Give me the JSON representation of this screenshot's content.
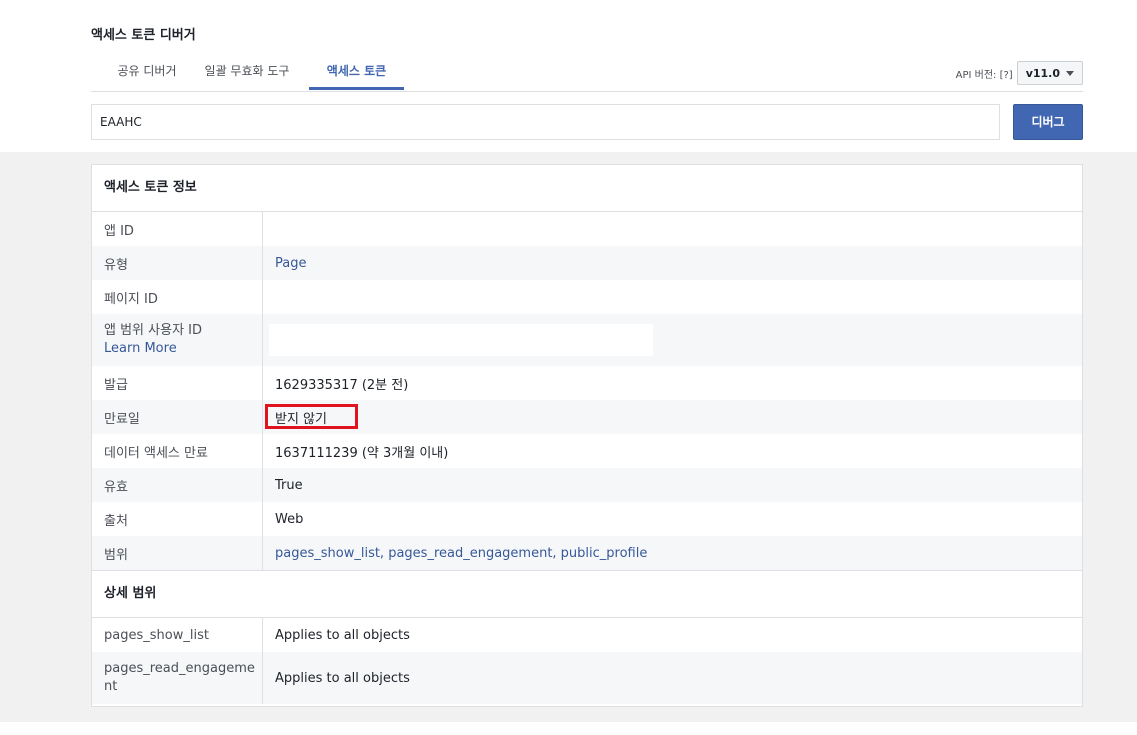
{
  "header": {
    "title": "액세스 토큰 디버거",
    "tabs": [
      {
        "label": "공유 디버거"
      },
      {
        "label": "일괄 무효화 도구"
      },
      {
        "label": "액세스 토큰"
      }
    ],
    "api_version_label": "API 버전: [?]",
    "api_version_value": "v11.0"
  },
  "token_input": {
    "value": "EAAHC"
  },
  "debug_button": {
    "label": "디버그"
  },
  "access_token_info": {
    "heading": "액세스 토큰 정보",
    "rows": {
      "app_id": {
        "label": "앱 ID",
        "value": ""
      },
      "type": {
        "label": "유형",
        "value": "Page"
      },
      "page_id": {
        "label": "페이지 ID",
        "value": ""
      },
      "app_scoped_user_id": {
        "label": "앱 범위 사용자 ID",
        "link": "Learn More",
        "value": ""
      },
      "issued": {
        "label": "발급",
        "value": "1629335317 (2분 전)"
      },
      "expires": {
        "label": "만료일",
        "value": "받지 않기"
      },
      "data_access_expires": {
        "label": "데이터 액세스 만료",
        "value": "1637111239 (약 3개월 이내)"
      },
      "valid": {
        "label": "유효",
        "value": "True"
      },
      "origin": {
        "label": "출처",
        "value": "Web"
      },
      "scopes": {
        "label": "범위",
        "value": "pages_show_list, pages_read_engagement, public_profile"
      }
    }
  },
  "granular_scopes": {
    "heading": "상세 범위",
    "rows": [
      {
        "scope": "pages_show_list",
        "target": "Applies to all objects"
      },
      {
        "scope": "pages_read_engagement",
        "target": "Applies to all objects"
      }
    ]
  },
  "colors": {
    "accent": "#4267b2",
    "link": "#365899",
    "highlight_border": "#e0141e",
    "page_background": "#f1f1f1"
  },
  "icons": {
    "version_dropdown": "chevron-down-icon"
  }
}
